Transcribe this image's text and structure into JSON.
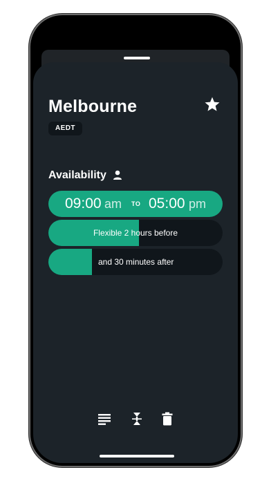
{
  "location": {
    "city": "Melbourne",
    "timezone": "AEDT"
  },
  "availability": {
    "title": "Availability",
    "start_time": "09:00",
    "start_ampm": "am",
    "separator": "TO",
    "end_time": "05:00",
    "end_ampm": "pm",
    "flex_before_label": "Flexible 2 hours before",
    "flex_before_fill": 0.52,
    "flex_after_label": "and 30 minutes after",
    "flex_after_fill": 0.25
  },
  "toolbar": {
    "icons": [
      "notes-icon",
      "collapse-icon",
      "trash-icon"
    ]
  },
  "colors": {
    "accent": "#18a882",
    "sheet_bg": "#1c2329",
    "track_bg": "#10161b"
  }
}
